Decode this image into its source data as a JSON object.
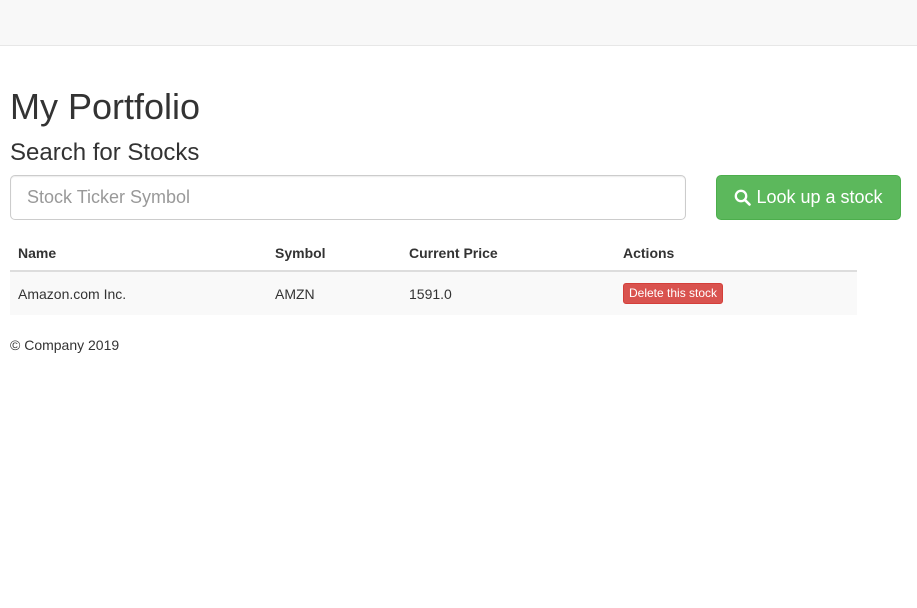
{
  "page": {
    "title": "My Portfolio",
    "subtitle": "Search for Stocks"
  },
  "search": {
    "placeholder": "Stock Ticker Symbol",
    "value": "",
    "button_label": "Look up a stock",
    "button_icon": "search-icon"
  },
  "table": {
    "headers": [
      "Name",
      "Symbol",
      "Current Price",
      "Actions"
    ],
    "rows": [
      {
        "name": "Amazon.com Inc.",
        "symbol": "AMZN",
        "price": "1591.0",
        "action_label": "Delete this stock"
      }
    ]
  },
  "footer": {
    "text": "© Company 2019"
  },
  "colors": {
    "success": "#5cb85c",
    "danger": "#d9534f",
    "navbar": "#f8f8f8"
  }
}
